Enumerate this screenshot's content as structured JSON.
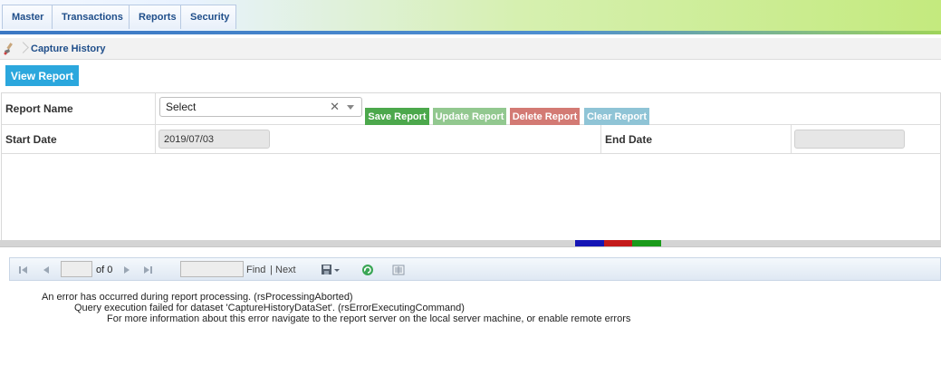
{
  "nav": {
    "tabs": [
      "Master",
      "Transactions",
      "Reports",
      "Security"
    ]
  },
  "breadcrumb": {
    "label": "Capture History",
    "icon": "brush-icon"
  },
  "actions": {
    "view_report": "View Report"
  },
  "form": {
    "report_name_label": "Report Name",
    "report_select_value": "Select",
    "save_report": "Save Report",
    "update_report": "Update Report",
    "delete_report": "Delete Report",
    "clear_report": "Clear Report",
    "start_date_label": "Start Date",
    "start_date_value": "2019/07/03",
    "end_date_label": "End Date",
    "end_date_value": ""
  },
  "viewer": {
    "page_value": "",
    "of_label": "of 0",
    "find_value": "",
    "find_label": "Find",
    "find_separator": "|",
    "next_label": "Next"
  },
  "errors": [
    "An error has occurred during report processing. (rsProcessingAborted)",
    "Query execution failed for dataset 'CaptureHistoryDataSet'. (rsErrorExecutingCommand)",
    "For more information about this error navigate to the report server on the local server machine, or enable remote errors"
  ],
  "colors": {
    "view_button": "#2ba7dd",
    "save_button": "#4ca84c",
    "update_button": "#92c88f",
    "delete_button": "#d37a74",
    "clear_button": "#8fc4d6",
    "splitter_blue": "#1515b5",
    "splitter_red": "#c41a1a",
    "splitter_green": "#1a9a1a"
  }
}
